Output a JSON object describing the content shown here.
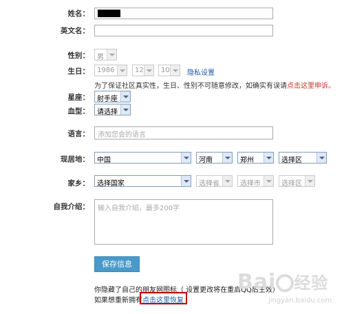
{
  "form": {
    "name": {
      "label": "姓名："
    },
    "english_name": {
      "label": "英文名：",
      "value": ""
    },
    "gender": {
      "label": "性别：",
      "selected": "男"
    },
    "birthday": {
      "label": "生日：",
      "year": "1986",
      "month": "12",
      "day": "10",
      "privacy_link": "隐私设置",
      "note_prefix": "为了保证社区真实性，生日、性别不可随意修改，如确实有误请",
      "note_link": "点击这里申诉。"
    },
    "constellation": {
      "label": "星座：",
      "selected": "射手座"
    },
    "blood_type": {
      "label": "血型：",
      "selected": "请选择"
    },
    "language": {
      "label": "语言：",
      "placeholder": "添加您会的语言"
    },
    "residence": {
      "label": "现居地：",
      "country": "中国",
      "province": "河南",
      "city": "郑州",
      "district": "选择区"
    },
    "hometown": {
      "label": "家乡：",
      "country": "选择国家",
      "province": "选择省",
      "city": "选择市",
      "district": "选择区"
    },
    "intro": {
      "label": "自我介绍：",
      "placeholder": "输入自我介绍，最多200字"
    },
    "save_button": "保存信息",
    "footer": {
      "line1": "你隐藏了自己的朋友网图标（ 设置更改将在重启QQ后生效）",
      "line2_prefix": "如果想重新拥有",
      "line2_link": "点击这里恢复"
    }
  },
  "watermark": {
    "brand": "Bai",
    "cn": "经验",
    "url": "jingyan.baidu.com"
  },
  "colors": {
    "link": "#1a5aa8",
    "button": "#4a9ac9",
    "highlight_box": "#c00000"
  }
}
